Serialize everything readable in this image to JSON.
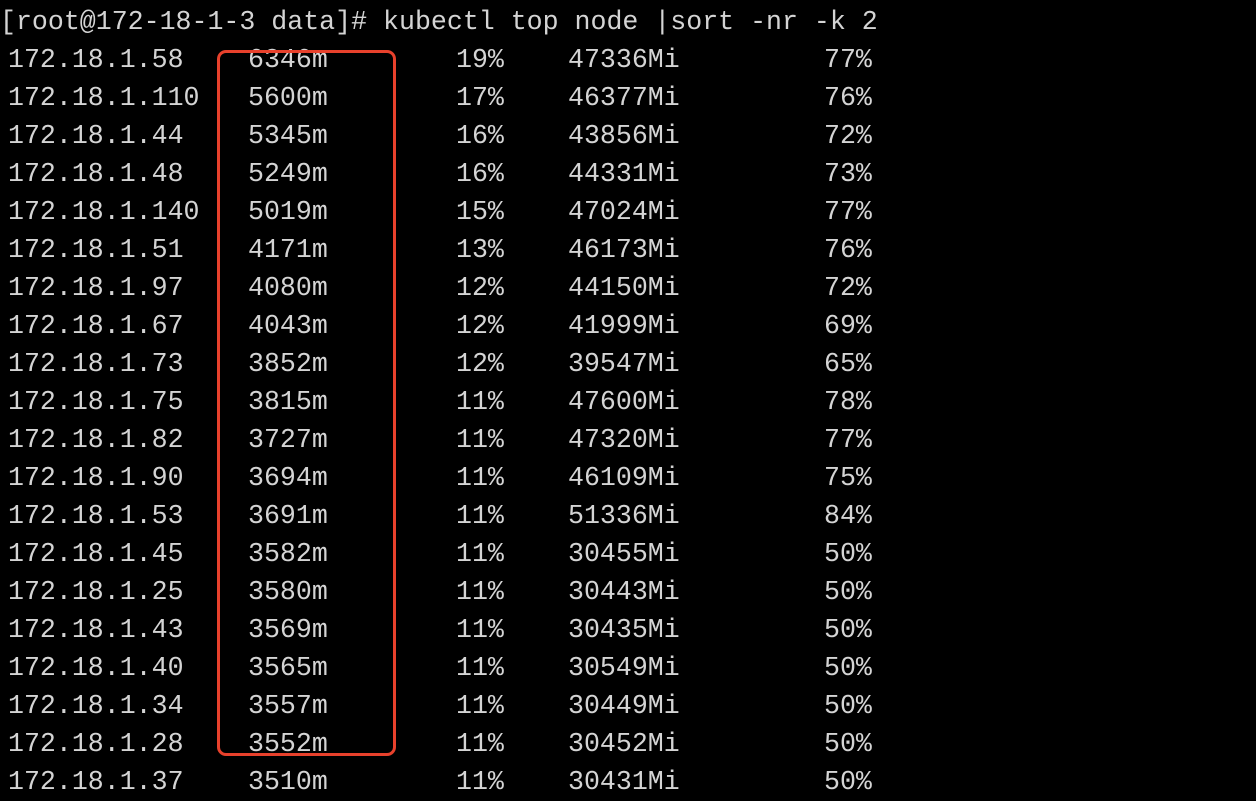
{
  "terminal": {
    "prompt": "[root@172-18-1-3 data]#",
    "command": "kubectl top node |sort -nr -k 2",
    "rows": [
      [
        "172.18.1.58",
        "6346m",
        "19%",
        "47336Mi",
        "77%"
      ],
      [
        "172.18.1.110",
        "5600m",
        "17%",
        "46377Mi",
        "76%"
      ],
      [
        "172.18.1.44",
        "5345m",
        "16%",
        "43856Mi",
        "72%"
      ],
      [
        "172.18.1.48",
        "5249m",
        "16%",
        "44331Mi",
        "73%"
      ],
      [
        "172.18.1.140",
        "5019m",
        "15%",
        "47024Mi",
        "77%"
      ],
      [
        "172.18.1.51",
        "4171m",
        "13%",
        "46173Mi",
        "76%"
      ],
      [
        "172.18.1.97",
        "4080m",
        "12%",
        "44150Mi",
        "72%"
      ],
      [
        "172.18.1.67",
        "4043m",
        "12%",
        "41999Mi",
        "69%"
      ],
      [
        "172.18.1.73",
        "3852m",
        "12%",
        "39547Mi",
        "65%"
      ],
      [
        "172.18.1.75",
        "3815m",
        "11%",
        "47600Mi",
        "78%"
      ],
      [
        "172.18.1.82",
        "3727m",
        "11%",
        "47320Mi",
        "77%"
      ],
      [
        "172.18.1.90",
        "3694m",
        "11%",
        "46109Mi",
        "75%"
      ],
      [
        "172.18.1.53",
        "3691m",
        "11%",
        "51336Mi",
        "84%"
      ],
      [
        "172.18.1.45",
        "3582m",
        "11%",
        "30455Mi",
        "50%"
      ],
      [
        "172.18.1.25",
        "3580m",
        "11%",
        "30443Mi",
        "50%"
      ],
      [
        "172.18.1.43",
        "3569m",
        "11%",
        "30435Mi",
        "50%"
      ],
      [
        "172.18.1.40",
        "3565m",
        "11%",
        "30549Mi",
        "50%"
      ],
      [
        "172.18.1.34",
        "3557m",
        "11%",
        "30449Mi",
        "50%"
      ],
      [
        "172.18.1.28",
        "3552m",
        "11%",
        "30452Mi",
        "50%"
      ],
      [
        "172.18.1.37",
        "3510m",
        "11%",
        "30431Mi",
        "50%"
      ]
    ]
  },
  "annotation": {
    "highlight_color": "#e8412c"
  }
}
